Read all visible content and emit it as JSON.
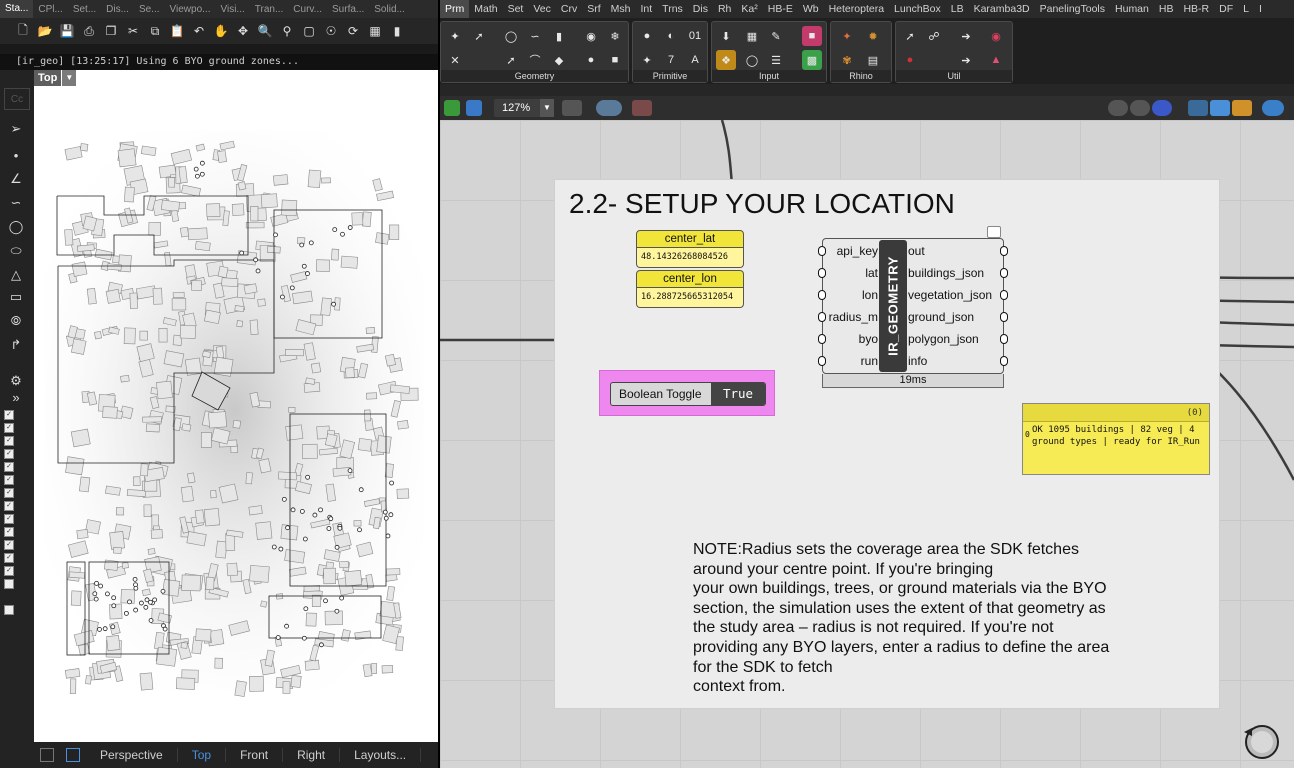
{
  "rhino": {
    "tabs": [
      "Sta...",
      "CPl...",
      "Set...",
      "Dis...",
      "Se...",
      "Viewpo...",
      "Visi...",
      "Tran...",
      "Curv...",
      "Surfa...",
      "Solid..."
    ],
    "command_line": "[ir_geo] [13:25:17] Using 6 BYO ground zones...",
    "viewport_name": "Top",
    "cc_label": "Cc",
    "bottom_tabs": [
      "Perspective",
      "Top",
      "Front",
      "Right",
      "Layouts..."
    ],
    "active_bottom_tab": "Top"
  },
  "gh": {
    "tabs": [
      "Prm",
      "Math",
      "Set",
      "Vec",
      "Crv",
      "Srf",
      "Msh",
      "Int",
      "Trns",
      "Dis",
      "Rh",
      "Ka²",
      "HB-E",
      "Wb",
      "Heteroptera",
      "LunchBox",
      "LB",
      "Karamba3D",
      "PanelingTools",
      "Human",
      "HB",
      "HB-R",
      "DF",
      "L",
      "I"
    ],
    "ribbon_panels": [
      "Geometry",
      "Primitive",
      "Input",
      "Rhino",
      "Util"
    ],
    "zoom": "127%",
    "group_title": "2.2- SETUP YOUR LOCATION",
    "sliders": [
      {
        "name": "center_lat",
        "value": "48.14326268084526"
      },
      {
        "name": "center_lon",
        "value": "16.288725665312054"
      }
    ],
    "toggle": {
      "label": "Boolean Toggle",
      "value": "True"
    },
    "component": {
      "name": "IR_GEOMETRY",
      "inputs": [
        "api_key",
        "lat",
        "lon",
        "radius_m",
        "byo",
        "run"
      ],
      "outputs": [
        "out",
        "buildings_json",
        "vegetation_json",
        "ground_json",
        "polygon_json",
        "info"
      ],
      "time": "19ms"
    },
    "panel": {
      "header": "(0)",
      "index": "0",
      "text": "OK  1095 buildings | 82 veg | 4 ground types | ready for IR_Run"
    },
    "note": "NOTE:Radius sets the coverage area the SDK fetches around your centre point. If you're bringing\n your own buildings, trees, or ground materials via the BYO section, the simulation uses the extent of that geometry as the study area – radius is not required. If you're not providing any BYO layers, enter a radius to define the area for the SDK to fetch\n context from."
  },
  "colors": {
    "slider_header": "#f2e53a",
    "slider_value": "#fff59c",
    "toggle_group": "#ee88ee",
    "panel_yellow": "#f6eb55",
    "component_dark": "#3a3a3a",
    "active_tab_blue": "#4a90e2"
  }
}
